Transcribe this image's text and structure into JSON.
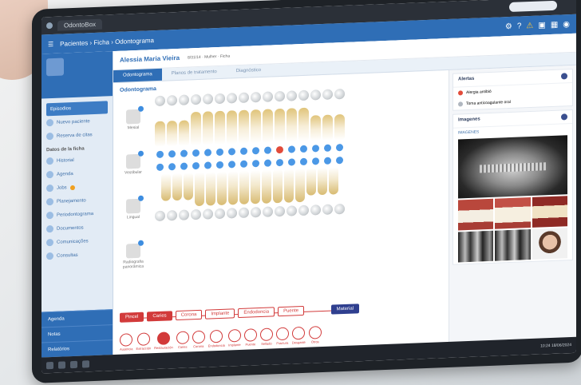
{
  "browser": {
    "tab": "OdontoBox"
  },
  "header": {
    "breadcrumb": "Pacientes › Ficha › Odontograma"
  },
  "patient_header": {
    "name": "Alessia Maria Vieira",
    "meta": "8/31/14 · Mulher · Ficha"
  },
  "tabs": [
    "Odontograma",
    "Planos de tratamento",
    "Diagnóstico"
  ],
  "sidebar": {
    "items": [
      "Nuevo paciente",
      "Reserva de citas",
      "Historial",
      "Agenda",
      "Jobs",
      "Planejamento",
      "Periodontograma",
      "Documentos",
      "Comunicações",
      "Consultas"
    ],
    "section": "Datos de la ficha",
    "bottom": [
      "Agenda",
      "Notas",
      "Relatórios"
    ],
    "button": "Episodios"
  },
  "odontogram": {
    "title": "Odontograma",
    "views": [
      "Mesial",
      "Vestibular",
      "Lingual",
      "Radiografia panorâmica"
    ]
  },
  "toolbar": {
    "left": "Pincel",
    "items": [
      "Caries",
      "Corona",
      "Implante",
      "Endodoncia",
      "Puente"
    ],
    "right": "Material"
  },
  "tools": [
    "Ausencia",
    "Extracción",
    "Restauración",
    "Caries",
    "Corona",
    "Endodoncia",
    "Implante",
    "Puente",
    "Sellado",
    "Fractura",
    "Desgaste",
    "Otros"
  ],
  "alerts": {
    "title": "Alertas",
    "items": [
      "Alergia antibió",
      "Toma anticoagulante oral"
    ]
  },
  "images": {
    "title": "Imagenes",
    "label": "IMAGENES"
  },
  "taskbar": {
    "clock": "10:24 18/06/2024"
  }
}
